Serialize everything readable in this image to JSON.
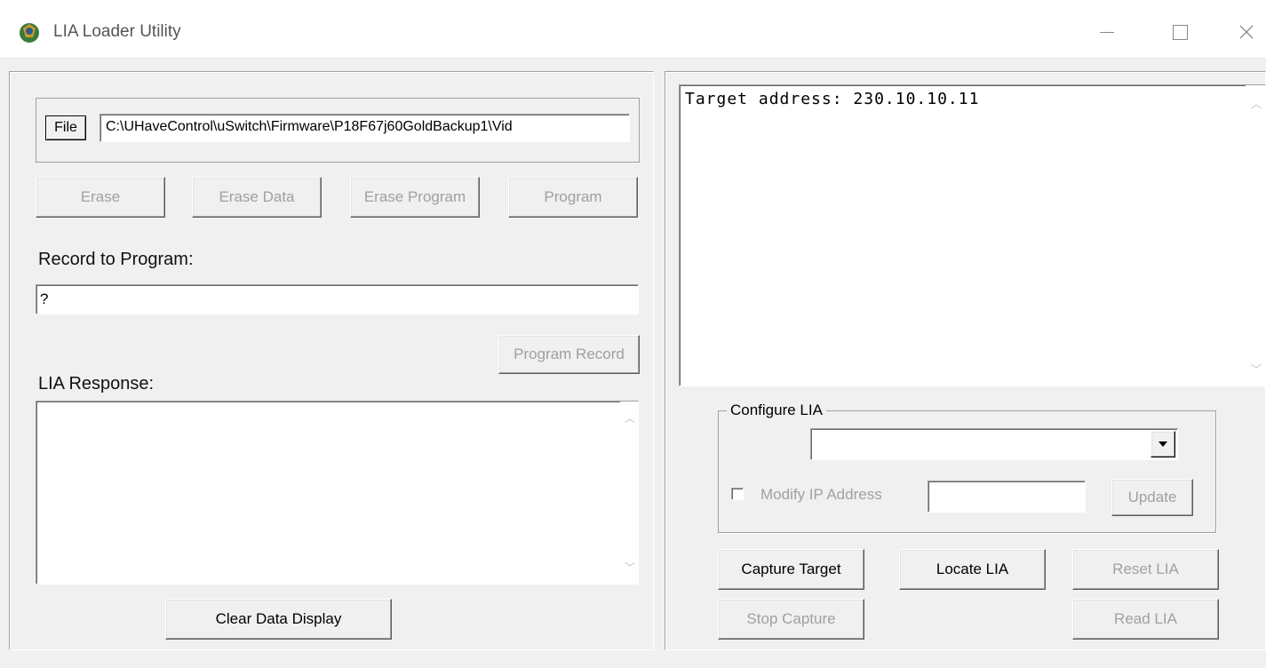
{
  "window": {
    "title": "LIA Loader Utility",
    "icons": {
      "app": "app-logo-icon",
      "minimize": "minimize-icon",
      "maximize": "maximize-icon",
      "close": "close-icon"
    }
  },
  "file": {
    "button_label": "File",
    "path": "C:\\UHaveControl\\uSwitch\\Firmware\\P18F67j60GoldBackup1\\Vid"
  },
  "actions": {
    "erase": "Erase",
    "erase_data": "Erase Data",
    "erase_program": "Erase Program",
    "program": "Program"
  },
  "record": {
    "label": "Record to Program:",
    "value": "?",
    "program_record": "Program Record"
  },
  "response": {
    "label": "LIA Response:",
    "value": "",
    "clear_button": "Clear Data Display"
  },
  "log": {
    "text": "Target address: 230.10.10.11"
  },
  "configure": {
    "group_label": "Configure LIA",
    "dropdown_value": "",
    "modify_ip_label": "Modify IP Address",
    "modify_ip_checked": false,
    "ip_value": "",
    "update_button": "Update"
  },
  "buttons": {
    "capture_target": "Capture Target",
    "locate_lia": "Locate LIA",
    "reset_lia": "Reset LIA",
    "stop_capture": "Stop Capture",
    "read_lia": "Read LIA"
  },
  "colors": {
    "window_bg": "#f0f0f0",
    "disabled_text": "#a0a0a0"
  }
}
